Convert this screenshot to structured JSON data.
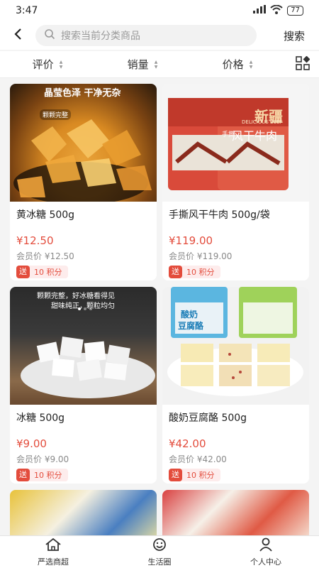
{
  "status": {
    "time": "3:47",
    "battery": "77"
  },
  "header": {
    "search_placeholder": "搜索当前分类商品",
    "search_button": "搜索"
  },
  "filters": [
    {
      "label": "评价"
    },
    {
      "label": "销量"
    },
    {
      "label": "价格"
    }
  ],
  "products": [
    {
      "name": "黄冰糖 500g",
      "price": "¥12.50",
      "member_price": "会员价 ¥12.50",
      "points_badge": "送",
      "points": "10 积分",
      "img_text": [
        "晶莹色泽 干净无杂",
        "颗颗完整"
      ]
    },
    {
      "name": "手撕风干牛肉 500g/袋",
      "price": "¥119.00",
      "member_price": "会员价 ¥119.00",
      "points_badge": "送",
      "points": "10 积分",
      "img_text": [
        "新疆",
        "风干牛肉",
        "DELICIOUS BEEF",
        "手撕"
      ]
    },
    {
      "name": "冰糖 500g",
      "price": "¥9.00",
      "member_price": "会员价 ¥9.00",
      "points_badge": "送",
      "points": "10 积分",
      "img_text": [
        "颗颗完整，好冰糖看得见",
        "甜味纯正，颗粒均匀"
      ]
    },
    {
      "name": "酸奶豆腐酪 500g",
      "price": "¥42.00",
      "member_price": "会员价 ¥42.00",
      "points_badge": "送",
      "points": "10 积分",
      "img_text": [
        "酸奶",
        "豆腐酪"
      ]
    }
  ],
  "tabs": [
    {
      "label": "严选商超",
      "icon": "home-icon"
    },
    {
      "label": "生活圈",
      "icon": "smile-icon"
    },
    {
      "label": "个人中心",
      "icon": "person-icon"
    }
  ],
  "colors": {
    "price": "#e34c3c",
    "points_bg": "#fdecec"
  }
}
